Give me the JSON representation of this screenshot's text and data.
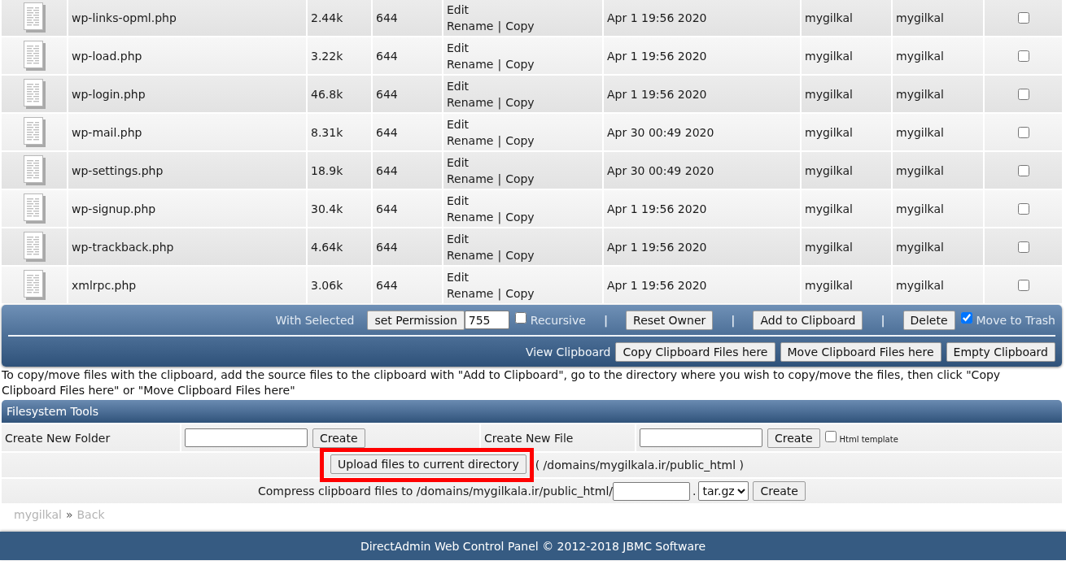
{
  "files": {
    "rows": [
      {
        "name": "wp-links-opml.php",
        "size": "2.44k",
        "permissions": "644",
        "actions": {
          "edit": "Edit",
          "rename": "Rename",
          "separator": "|",
          "copy": "Copy"
        },
        "modified": "Apr 1 19:56 2020",
        "owner": "mygilkal",
        "group": "mygilkal",
        "checked": false
      },
      {
        "name": "wp-load.php",
        "size": "3.22k",
        "permissions": "644",
        "actions": {
          "edit": "Edit",
          "rename": "Rename",
          "separator": "|",
          "copy": "Copy"
        },
        "modified": "Apr 1 19:56 2020",
        "owner": "mygilkal",
        "group": "mygilkal",
        "checked": false
      },
      {
        "name": "wp-login.php",
        "size": "46.8k",
        "permissions": "644",
        "actions": {
          "edit": "Edit",
          "rename": "Rename",
          "separator": "|",
          "copy": "Copy"
        },
        "modified": "Apr 1 19:56 2020",
        "owner": "mygilkal",
        "group": "mygilkal",
        "checked": false
      },
      {
        "name": "wp-mail.php",
        "size": "8.31k",
        "permissions": "644",
        "actions": {
          "edit": "Edit",
          "rename": "Rename",
          "separator": "|",
          "copy": "Copy"
        },
        "modified": "Apr 30 00:49 2020",
        "owner": "mygilkal",
        "group": "mygilkal",
        "checked": false
      },
      {
        "name": "wp-settings.php",
        "size": "18.9k",
        "permissions": "644",
        "actions": {
          "edit": "Edit",
          "rename": "Rename",
          "separator": "|",
          "copy": "Copy"
        },
        "modified": "Apr 30 00:49 2020",
        "owner": "mygilkal",
        "group": "mygilkal",
        "checked": false
      },
      {
        "name": "wp-signup.php",
        "size": "30.4k",
        "permissions": "644",
        "actions": {
          "edit": "Edit",
          "rename": "Rename",
          "separator": "|",
          "copy": "Copy"
        },
        "modified": "Apr 1 19:56 2020",
        "owner": "mygilkal",
        "group": "mygilkal",
        "checked": false
      },
      {
        "name": "wp-trackback.php",
        "size": "4.64k",
        "permissions": "644",
        "actions": {
          "edit": "Edit",
          "rename": "Rename",
          "separator": "|",
          "copy": "Copy"
        },
        "modified": "Apr 1 19:56 2020",
        "owner": "mygilkal",
        "group": "mygilkal",
        "checked": false
      },
      {
        "name": "xmlrpc.php",
        "size": "3.06k",
        "permissions": "644",
        "actions": {
          "edit": "Edit",
          "rename": "Rename",
          "separator": "|",
          "copy": "Copy"
        },
        "modified": "Apr 1 19:56 2020",
        "owner": "mygilkal",
        "group": "mygilkal",
        "checked": false
      }
    ]
  },
  "selection_toolbar": {
    "actions": [
      {
        "kind": "label",
        "text": "With Selected"
      },
      {
        "kind": "button",
        "text": "set Permission"
      },
      {
        "kind": "input",
        "value": "755"
      },
      {
        "kind": "checkbox",
        "label": "Recursive",
        "checked": false
      },
      {
        "kind": "separator",
        "text": "|"
      },
      {
        "kind": "button",
        "text": "Reset Owner"
      },
      {
        "kind": "separator",
        "text": "|"
      },
      {
        "kind": "button",
        "text": "Add to Clipboard"
      },
      {
        "kind": "separator",
        "text": "|"
      },
      {
        "kind": "button",
        "text": "Delete"
      },
      {
        "kind": "checkbox",
        "label": "Move to Trash",
        "checked": true
      }
    ],
    "clipboard": [
      {
        "kind": "link",
        "text": "View Clipboard"
      },
      {
        "kind": "button",
        "text": "Copy Clipboard Files here"
      },
      {
        "kind": "button",
        "text": "Move Clipboard Files here"
      },
      {
        "kind": "button",
        "text": "Empty Clipboard"
      }
    ]
  },
  "clipboard_help": "To copy/move files with the clipboard, add the source files to the clipboard with \"Add to Clipboard\", go to the directory where you wish to copy/move the files, then click \"Copy Clipboard Files here\" or \"Move Clipboard Files here\"",
  "filesystem_tools": {
    "title": "Filesystem Tools",
    "create_folder": {
      "label": "Create New Folder",
      "button": "Create"
    },
    "create_file": {
      "label": "Create New File",
      "button": "Create",
      "html_template": {
        "label": "Html template",
        "checked": false
      }
    },
    "upload": {
      "button": "Upload files to current directory",
      "highlighted": true,
      "path": "( /domains/mygilkala.ir/public_html )"
    },
    "compress": {
      "label": "Compress clipboard files to /domains/mygilkala.ir/public_html/",
      "separator": ".",
      "format": "tar.gz",
      "button": "Create"
    }
  },
  "breadcrumb": {
    "items": [
      {
        "text": "mygilkal"
      },
      {
        "text": "Back"
      }
    ],
    "separator": "»"
  },
  "footer": {
    "text": "DirectAdmin Web Control Panel © 2012-2018 JBMC Software"
  }
}
